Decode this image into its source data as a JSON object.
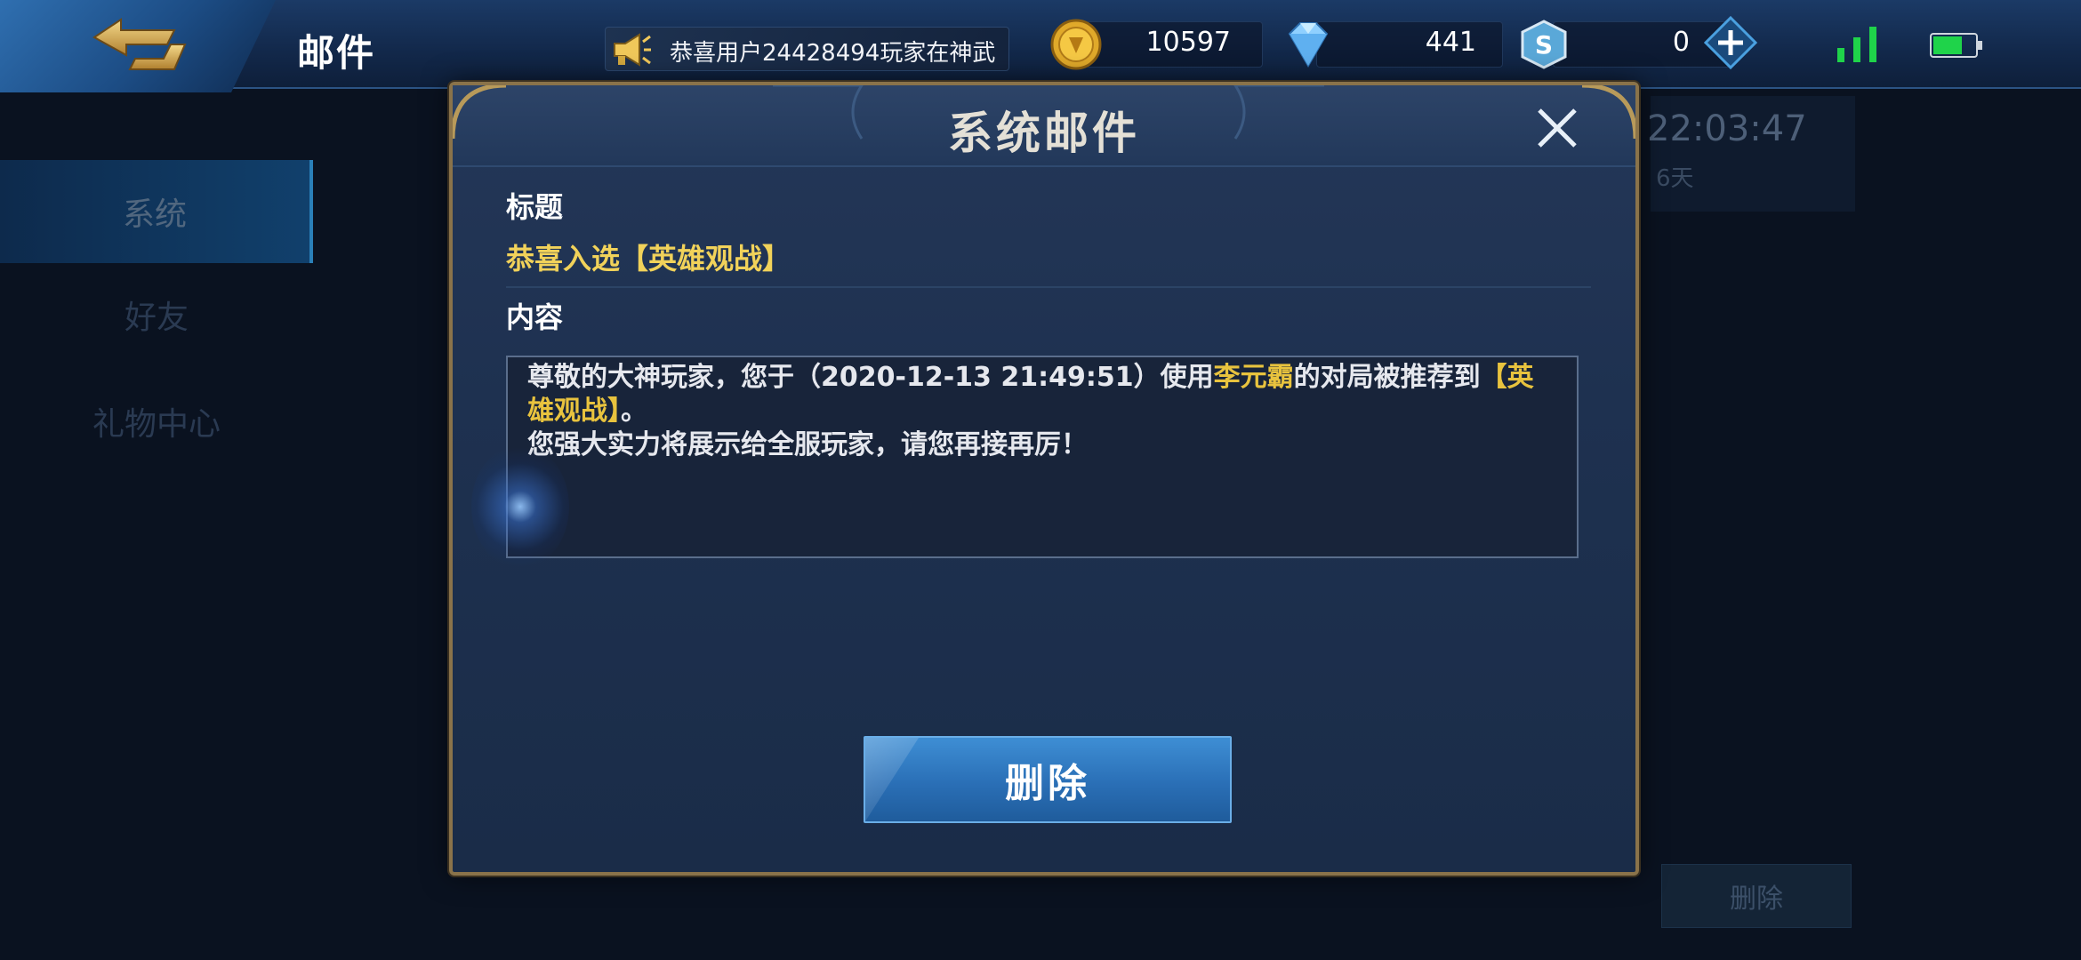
{
  "header": {
    "title": "邮件",
    "broadcast": "恭喜用户24428494玩家在神武",
    "currencies": {
      "gold": "10597",
      "diamond": "441",
      "voucher": "0"
    }
  },
  "sidebar": {
    "items": [
      {
        "label": "系统"
      },
      {
        "label": "好友"
      },
      {
        "label": "礼物中心"
      }
    ]
  },
  "background_mail": {
    "time": "22:03:47",
    "days": "6天",
    "delete_label": "删除"
  },
  "modal": {
    "title": "系统邮件",
    "subject_label": "标题",
    "subject": "恭喜入选【英雄观战】",
    "content_label": "内容",
    "content": {
      "part1": "尊敬的大神玩家，您于（2020-12-13 21:49:51）使用",
      "hero": "李元霸",
      "part2": "的对局被推荐到",
      "channel": "【英雄观战】",
      "part3": "。",
      "line2": "您强大实力将展示给全服玩家，请您再接再厉！"
    },
    "delete_label": "删除"
  },
  "colors": {
    "accent_gold": "#f1d25a",
    "button_blue": "#2a6fb6",
    "frame_gold": "#8a734a"
  },
  "icons": [
    "back-arrow-icon",
    "megaphone-icon",
    "gold-coin-icon",
    "diamond-icon",
    "voucher-icon",
    "plus-icon",
    "signal-icon",
    "battery-icon",
    "close-icon"
  ]
}
